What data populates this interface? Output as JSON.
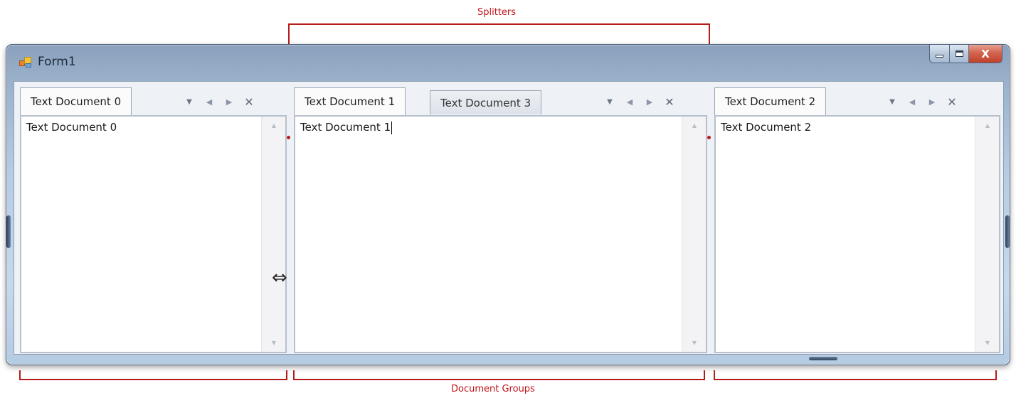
{
  "annotations": {
    "top_label": "Splitters",
    "bottom_label": "Document Groups"
  },
  "window": {
    "title": "Form1",
    "controls": {
      "close_glyph": "X"
    }
  },
  "groups": [
    {
      "tabs": [
        {
          "label": "Text Document 0",
          "active": true
        }
      ],
      "content": "Text Document 0"
    },
    {
      "tabs": [
        {
          "label": "Text Document 1",
          "active": true
        },
        {
          "label": "Text Document 3",
          "active": false
        }
      ],
      "content": "Text Document 1"
    },
    {
      "tabs": [
        {
          "label": "Text Document 2",
          "active": true
        }
      ],
      "content": "Text Document 2"
    }
  ],
  "icons": {
    "app": "form-app-icon",
    "dropdown": "chevron-down-icon",
    "scroll_left": "arrow-left-icon",
    "scroll_right": "arrow-right-icon",
    "close_doc": "close-icon",
    "resize": "resize-horizontal-cursor-icon"
  },
  "colors": {
    "annotation": "#b71c1c",
    "title_bar": "#8aa0bc",
    "close_button": "#c9513a"
  }
}
